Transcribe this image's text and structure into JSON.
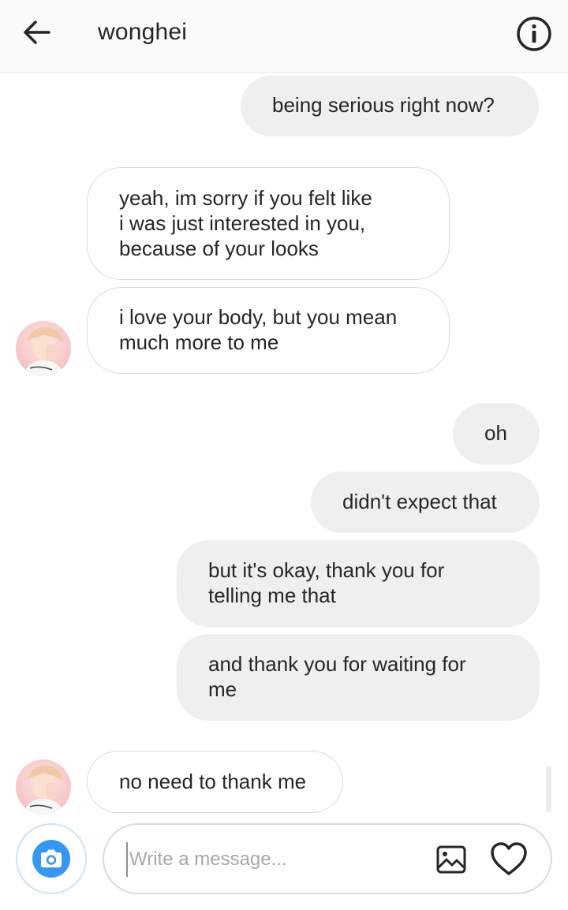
{
  "header": {
    "title": "wonghei"
  },
  "messages": [
    {
      "from": "me",
      "text": "being serious right now?"
    },
    {
      "from": "wonghei",
      "text": "yeah, im sorry if you felt like\ni was just interested in you,\nbecause of your looks"
    },
    {
      "from": "wonghei",
      "text": "i love your body, but you mean\nmuch more to me"
    },
    {
      "from": "me",
      "text": "oh"
    },
    {
      "from": "me",
      "text": "didn't expect that"
    },
    {
      "from": "me",
      "text": "but it's okay, thank you for\ntelling me that"
    },
    {
      "from": "me",
      "text": "and thank you for waiting for\nme"
    },
    {
      "from": "wonghei",
      "text": "no need to thank me"
    }
  ],
  "composer": {
    "placeholder": "Write a message..."
  },
  "colors": {
    "sent_bubble": "#efefef",
    "received_border": "#dbdbdb",
    "accent": "#3897f0"
  },
  "icons": [
    "back-arrow-icon",
    "info-icon",
    "camera-icon",
    "gallery-icon",
    "heart-icon"
  ]
}
